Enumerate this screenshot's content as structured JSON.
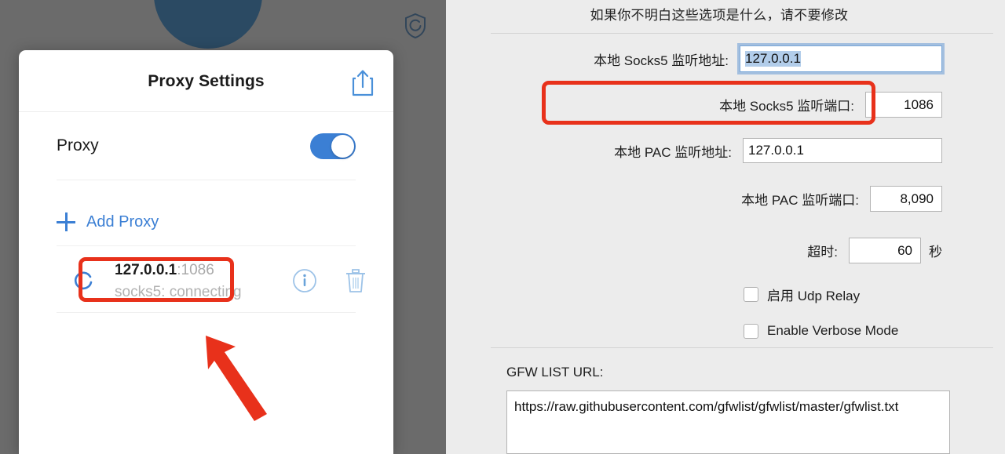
{
  "backdrop": {
    "shield_icon": "shield-icon"
  },
  "dialog": {
    "title": "Proxy Settings",
    "share_icon": "share-icon",
    "proxy_row": {
      "label": "Proxy",
      "toggle_state": "on"
    },
    "add_proxy": {
      "label": "Add Proxy",
      "icon": "plus-icon"
    },
    "proxy_item": {
      "spinner_icon": "spinner-icon",
      "address": "127.0.0.1",
      "port": ":1086",
      "status": "socks5: connecting",
      "info_icon": "info-circle-icon",
      "trash_icon": "trash-icon"
    }
  },
  "prefs": {
    "notice": "如果你不明白这些选项是什么，请不要修改",
    "fields": [
      {
        "label": "本地 Socks5 监听地址:",
        "value": "127.0.0.1"
      },
      {
        "label": "本地 Socks5 监听端口:",
        "value": "1086"
      },
      {
        "label": "本地 PAC 监听地址:",
        "value": "127.0.0.1"
      },
      {
        "label": "本地 PAC 监听端口:",
        "value": "8,090"
      },
      {
        "label": "超时:",
        "value": "60",
        "unit": "秒"
      }
    ],
    "checkboxes": [
      {
        "label": "启用 Udp Relay",
        "checked": false
      },
      {
        "label": "Enable Verbose Mode",
        "checked": false
      }
    ],
    "gfw": {
      "label": "GFW LIST URL:",
      "url": "https://raw.githubusercontent.com/gfwlist/gfwlist/master/gfwlist.txt"
    }
  },
  "annotations": {
    "highlight_color": "#e8311b",
    "boxes": [
      {
        "name": "proxy-entry-highlight"
      },
      {
        "name": "socks5-port-highlight"
      }
    ],
    "arrow": {
      "name": "pointer-arrow"
    }
  }
}
